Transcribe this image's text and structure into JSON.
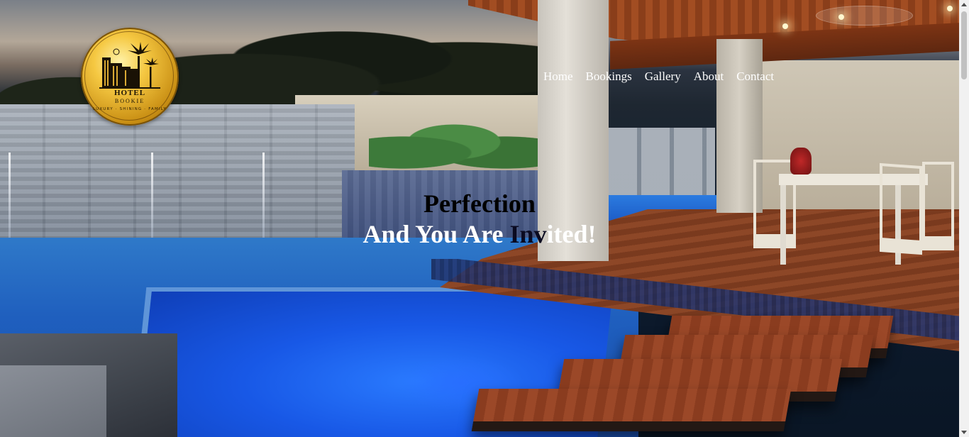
{
  "brand": {
    "name_line1": "HOTEL",
    "name_line2": "BOOKIE",
    "tagline": "LUXURY · SHINING · FAMILY",
    "logo_icon": "hotel-palm-logo",
    "logo_color": "#d4a52a"
  },
  "nav": {
    "items": [
      {
        "label": "Home"
      },
      {
        "label": "Bookings"
      },
      {
        "label": "Gallery"
      },
      {
        "label": "About"
      },
      {
        "label": "Contact"
      }
    ]
  },
  "hero": {
    "line1": "Perfection",
    "line2_light": "And You Are ",
    "line2_dark": "Inv",
    "line2_end": "ited!",
    "background": "pool-patio-night-photo"
  }
}
